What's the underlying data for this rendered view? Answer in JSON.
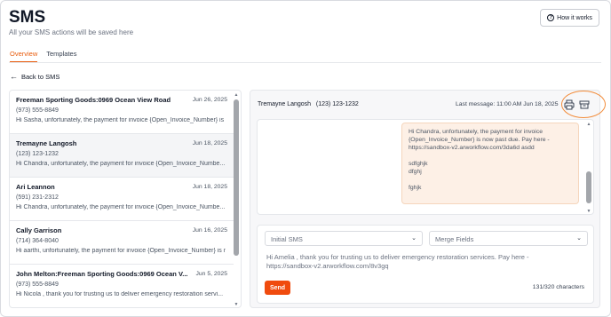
{
  "header": {
    "title": "SMS",
    "subtitle": "All your SMS actions will be saved here",
    "help_button": "How it works"
  },
  "tabs": [
    {
      "label": "Overview",
      "active": true
    },
    {
      "label": "Templates",
      "active": false
    }
  ],
  "back_link": "Back to SMS",
  "conversations": [
    {
      "name": "Freeman Sporting Goods:0969 Ocean View Road",
      "date": "Jun 26, 2025",
      "phone": "(973) 555-8849",
      "preview": "Hi Sasha, unfortunately, the payment for invoice {Open_Invoice_Number} is now past due.",
      "selected": false
    },
    {
      "name": "Tremayne Langosh",
      "date": "Jun 18, 2025",
      "phone": "(123) 123-1232",
      "preview": "Hi Chandra, unfortunately, the payment for invoice {Open_Invoice_Numbe...",
      "selected": true
    },
    {
      "name": "Ari Leannon",
      "date": "Jun 18, 2025",
      "phone": "(591) 231-2312",
      "preview": "Hi Chandra, unfortunately, the payment for invoice {Open_Invoice_Numbe...",
      "selected": false
    },
    {
      "name": "Cally Garrison",
      "date": "Jun 16, 2025",
      "phone": "(714) 364-8040",
      "preview": "Hi aarthi, unfortunately, the payment for invoice {Open_Invoice_Number} is now past due.",
      "selected": false
    },
    {
      "name": "John Melton:Freeman Sporting Goods:0969 Ocean V...",
      "date": "Jun 5, 2025",
      "phone": "(973) 555-8849",
      "preview": "Hi Nicola , thank you for trusting us to deliver emergency restoration servi...",
      "selected": false
    }
  ],
  "thread": {
    "contact_name": "Tremayne Langosh",
    "contact_phone": "(123) 123-1232",
    "last_message": "Last message: 11:00 AM Jun 18, 2025",
    "message_lines": [
      "Hi Chandra, unfortunately, the payment for invoice",
      "{Open_Invoice_Number} is now past due. Pay here -",
      "https://sandbox-v2.arworkflow.com/3da6d asdd",
      "",
      "sdfghjk",
      "dfghj",
      "",
      "fghjk"
    ]
  },
  "compose": {
    "template_select": "Initial SMS",
    "merge_select": "Merge Fields",
    "text": "Hi Amelia , thank you for trusting us to deliver emergency restoration services. Pay here - https://sandbox-v2.arworkflow.com/8v3gq",
    "send_label": "Send",
    "char_count": "131/320 characters"
  },
  "colors": {
    "accent": "#e85c0d",
    "send": "#f04b0e",
    "bubble": "#fdf0e6",
    "annotation_circle": "#f28c3b"
  },
  "icons": [
    "question-circle-icon",
    "arrow-left-icon",
    "printer-icon",
    "archive-icon",
    "chevron-down-icon"
  ]
}
